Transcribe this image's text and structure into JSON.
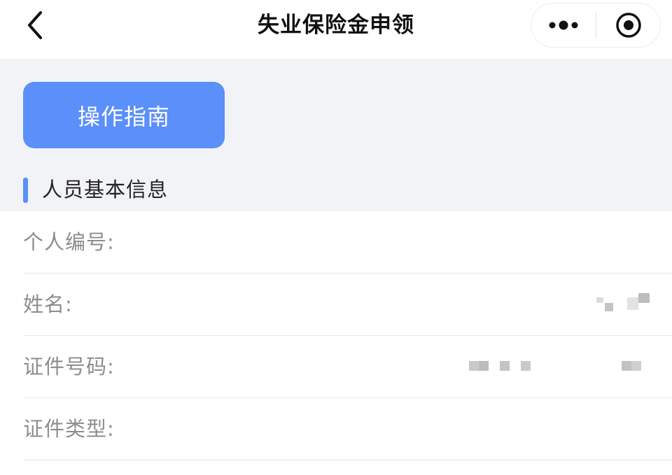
{
  "navbar": {
    "title": "失业保险金申领",
    "back_icon": "chevron-left-icon",
    "more_icon": "more-dots-icon",
    "close_icon": "target-circle-icon"
  },
  "guide_button": {
    "label": "操作指南"
  },
  "section": {
    "title": "人员基本信息"
  },
  "form": {
    "rows": [
      {
        "label": "个人编号:",
        "value": ""
      },
      {
        "label": "姓名:",
        "value": ""
      },
      {
        "label": "证件号码:",
        "value": ""
      },
      {
        "label": "证件类型:",
        "value": ""
      }
    ]
  },
  "colors": {
    "accent": "#5b8ff9",
    "header_bg": "#f2f3f7",
    "label_text": "#8d8d8d",
    "redaction": "#c9c9c9"
  }
}
